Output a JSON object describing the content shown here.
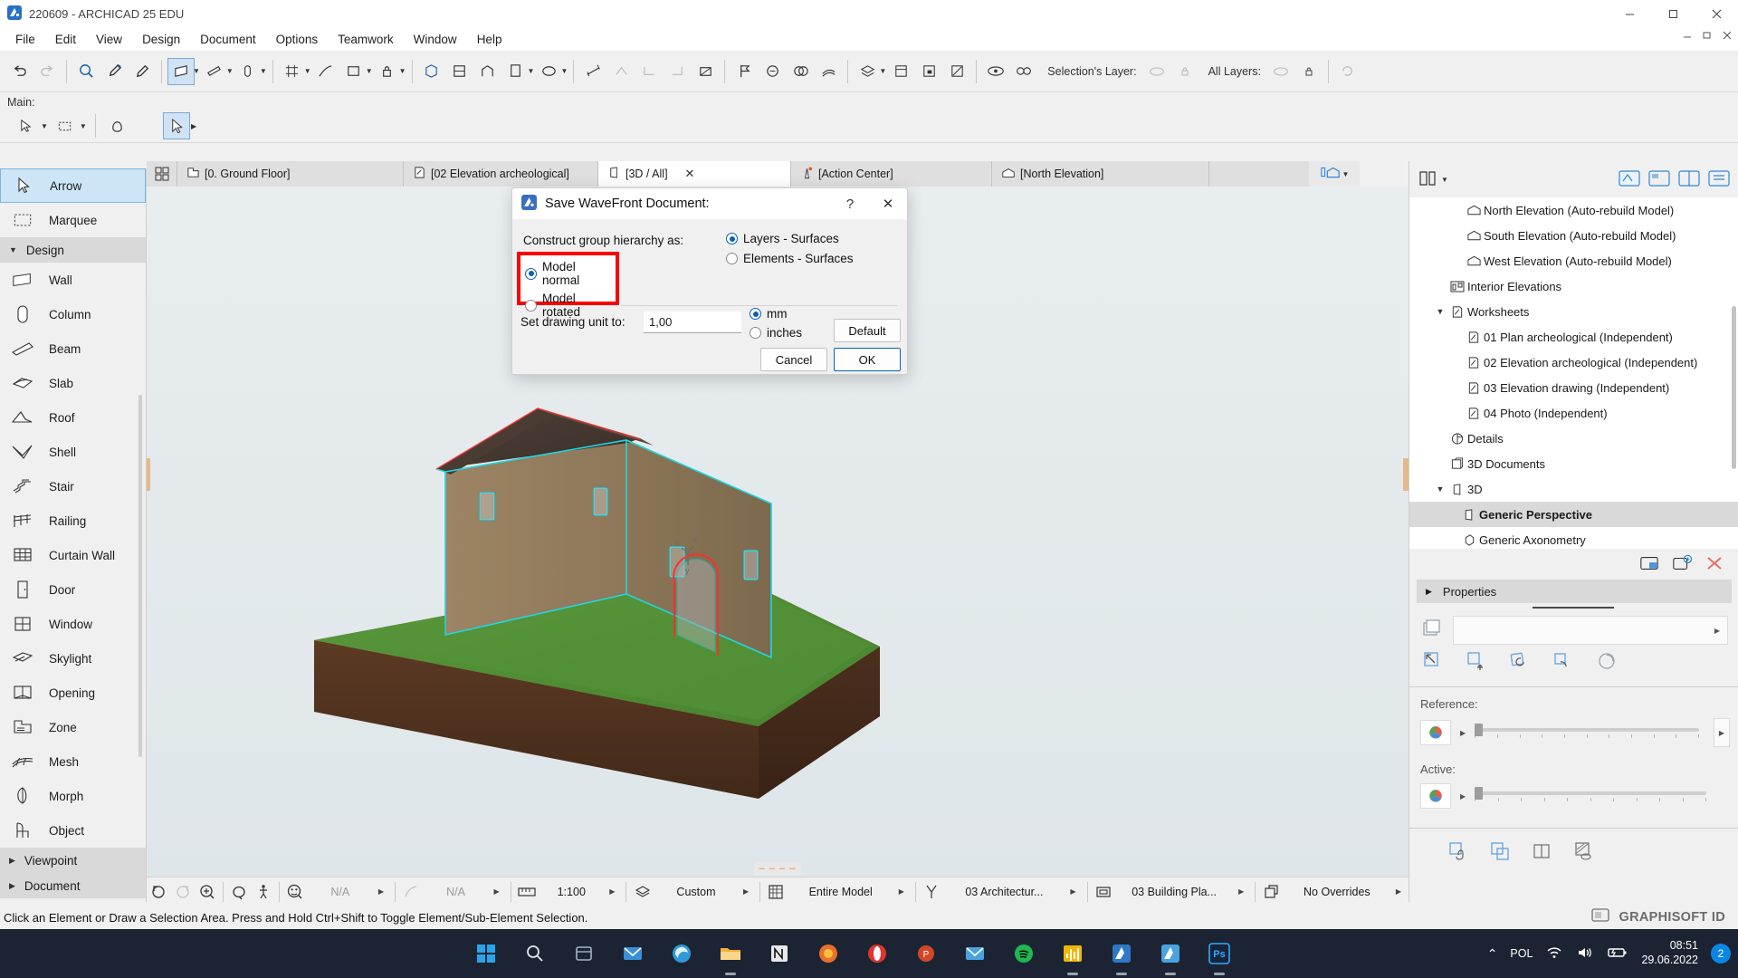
{
  "window": {
    "title": "220609 - ARCHICAD 25 EDU",
    "app_icon": "archicad-icon",
    "minimize": "–",
    "maximize": "▢",
    "close": "✕"
  },
  "menubar": {
    "items": [
      "File",
      "Edit",
      "View",
      "Design",
      "Document",
      "Options",
      "Teamwork",
      "Window",
      "Help"
    ]
  },
  "toolbar": {
    "selections_layer_label": "Selection's Layer:",
    "all_layers_label": "All Layers:"
  },
  "mainbar": {
    "label": "Main:"
  },
  "toolbox": {
    "items": [
      {
        "label": "Arrow",
        "icon": "arrow-cursor-icon",
        "active": true
      },
      {
        "label": "Marquee",
        "icon": "marquee-icon",
        "active": false
      },
      {
        "label": "Design",
        "icon": "group-collapse-icon",
        "group": true,
        "expanded": true
      },
      {
        "label": "Wall",
        "icon": "wall-icon",
        "active": false
      },
      {
        "label": "Column",
        "icon": "column-icon",
        "active": false
      },
      {
        "label": "Beam",
        "icon": "beam-icon",
        "active": false
      },
      {
        "label": "Slab",
        "icon": "slab-icon",
        "active": false
      },
      {
        "label": "Roof",
        "icon": "roof-icon",
        "active": false
      },
      {
        "label": "Shell",
        "icon": "shell-icon",
        "active": false
      },
      {
        "label": "Stair",
        "icon": "stair-icon",
        "active": false
      },
      {
        "label": "Railing",
        "icon": "railing-icon",
        "active": false
      },
      {
        "label": "Curtain Wall",
        "icon": "curtain-wall-icon",
        "active": false
      },
      {
        "label": "Door",
        "icon": "door-icon",
        "active": false
      },
      {
        "label": "Window",
        "icon": "window-icon",
        "active": false
      },
      {
        "label": "Skylight",
        "icon": "skylight-icon",
        "active": false
      },
      {
        "label": "Opening",
        "icon": "opening-icon",
        "active": false
      },
      {
        "label": "Zone",
        "icon": "zone-icon",
        "active": false
      },
      {
        "label": "Mesh",
        "icon": "mesh-icon",
        "active": false
      },
      {
        "label": "Morph",
        "icon": "morph-icon",
        "active": false
      },
      {
        "label": "Object",
        "icon": "object-icon",
        "active": false
      },
      {
        "label": "Viewpoint",
        "icon": "group-expand-icon",
        "group": true,
        "expanded": false
      },
      {
        "label": "Document",
        "icon": "group-expand-icon",
        "group": true,
        "expanded": false
      }
    ]
  },
  "tabs": [
    {
      "label": "[0. Ground Floor]",
      "icon": "floor-plan-icon",
      "active": false,
      "closable": false
    },
    {
      "label": "[02 Elevation archeological]",
      "icon": "worksheet-icon",
      "active": false,
      "closable": false
    },
    {
      "label": "[3D / All]",
      "icon": "3d-view-icon",
      "active": true,
      "closable": true
    },
    {
      "label": "[Action Center]",
      "icon": "action-center-icon",
      "active": false,
      "closable": false
    },
    {
      "label": "[North Elevation]",
      "icon": "elevation-icon",
      "active": false,
      "closable": false
    }
  ],
  "canvas": {
    "top_handle": "– – – –",
    "bottom_handle": "– – – –"
  },
  "navigator": {
    "tree": [
      {
        "label": "North Elevation (Auto-rebuild Model)",
        "icon": "elevation-icon",
        "indent": 2,
        "caret": "",
        "selected": false
      },
      {
        "label": "South Elevation (Auto-rebuild Model)",
        "icon": "elevation-icon",
        "indent": 2,
        "caret": "",
        "selected": false
      },
      {
        "label": "West Elevation (Auto-rebuild Model)",
        "icon": "elevation-icon",
        "indent": 2,
        "caret": "",
        "selected": false
      },
      {
        "label": "Interior Elevations",
        "icon": "interior-elevation-icon",
        "indent": 1,
        "caret": "",
        "selected": false
      },
      {
        "label": "Worksheets",
        "icon": "worksheet-icon",
        "indent": 1,
        "caret": "▼",
        "selected": false
      },
      {
        "label": "01 Plan archeological (Independent)",
        "icon": "worksheet-icon",
        "indent": 2,
        "caret": "",
        "selected": false
      },
      {
        "label": "02 Elevation archeological (Independent)",
        "icon": "worksheet-icon",
        "indent": 2,
        "caret": "",
        "selected": false
      },
      {
        "label": "03 Elevation drawing  (Independent)",
        "icon": "worksheet-icon",
        "indent": 2,
        "caret": "",
        "selected": false
      },
      {
        "label": "04 Photo  (Independent)",
        "icon": "worksheet-icon",
        "indent": 2,
        "caret": "",
        "selected": false
      },
      {
        "label": "Details",
        "icon": "details-icon",
        "indent": 1,
        "caret": "",
        "selected": false
      },
      {
        "label": "3D Documents",
        "icon": "3d-document-icon",
        "indent": 1,
        "caret": "",
        "selected": false
      },
      {
        "label": "3D",
        "icon": "3d-view-icon",
        "indent": 1,
        "caret": "▼",
        "selected": false
      },
      {
        "label": "Generic Perspective",
        "icon": "3d-view-icon",
        "indent": 2,
        "caret": "",
        "selected": true
      },
      {
        "label": "Generic Axonometry",
        "icon": "axonometry-icon",
        "indent": 2,
        "caret": "",
        "selected": false
      }
    ],
    "properties_label": "Properties",
    "reference_label": "Reference:",
    "active_label": "Active:"
  },
  "statusbar": {
    "value_na_1": "N/A",
    "value_na_2": "N/A",
    "scale": "1:100",
    "pen_set": "Custom",
    "model_view": "Entire Model",
    "renovation": "03 Architectur...",
    "layer_combo": "03 Building Pla...",
    "overrides": "No Overrides",
    "message": "Click an Element or Draw a Selection Area. Press and Hold Ctrl+Shift to Toggle Element/Sub-Element Selection.",
    "graphisoft_id": "GRAPHISOFT ID"
  },
  "dialog": {
    "title": "Save WaveFront Document:",
    "help_btn": "?",
    "close_btn": "✕",
    "construct_label": "Construct group hierarchy as:",
    "hierarchy_options": [
      {
        "label": "Layers - Surfaces",
        "selected": true
      },
      {
        "label": "Elements - Surfaces",
        "selected": false
      }
    ],
    "model_options": [
      {
        "label": "Model normal",
        "selected": true
      },
      {
        "label": "Model rotated",
        "selected": false
      }
    ],
    "unit_label": "Set drawing unit to:",
    "unit_value": "1,00",
    "unit_options": [
      {
        "label": "mm",
        "selected": true
      },
      {
        "label": "inches",
        "selected": false
      }
    ],
    "default_btn": "Default",
    "cancel_btn": "Cancel",
    "ok_btn": "OK",
    "highlight_color": "#f70404"
  },
  "taskbar": {
    "apps": [
      {
        "name": "start-windows-icon",
        "glyph": "▦",
        "color": "#2aa4e8",
        "running": false
      },
      {
        "name": "search-icon",
        "glyph": "◯",
        "color": "#dfe6ee",
        "running": false
      },
      {
        "name": "store-icon",
        "glyph": "▤",
        "color": "#9fb6cc",
        "running": false
      },
      {
        "name": "mail-icon",
        "glyph": "✉",
        "color": "#3a8fd8",
        "running": false
      },
      {
        "name": "edge-browser-icon",
        "glyph": "◉",
        "color": "#2f9ad6",
        "running": false
      },
      {
        "name": "file-explorer-icon",
        "glyph": "▭",
        "color": "#f0b33c",
        "running": true
      },
      {
        "name": "notion-icon",
        "glyph": "N",
        "color": "#e9e9e9",
        "running": false
      },
      {
        "name": "firefox-icon",
        "glyph": "◍",
        "color": "#e9702a",
        "running": false
      },
      {
        "name": "opera-icon",
        "glyph": "O",
        "color": "#e2342e",
        "running": false
      },
      {
        "name": "powerpoint-icon",
        "glyph": "P",
        "color": "#d24726",
        "running": false
      },
      {
        "name": "mail2-icon",
        "glyph": "✉",
        "color": "#4aa3df",
        "running": false
      },
      {
        "name": "spotify-icon",
        "glyph": "♫",
        "color": "#1db954",
        "running": false
      },
      {
        "name": "audacity-icon",
        "glyph": "▮",
        "color": "#f2b705",
        "running": true
      },
      {
        "name": "archicad-taskbar-icon",
        "glyph": "◣",
        "color": "#2f78c4",
        "running": true
      },
      {
        "name": "archicad-active-icon",
        "glyph": "◤",
        "color": "#4aa3df",
        "running": true
      },
      {
        "name": "photoshop-icon",
        "glyph": "Ps",
        "color": "#31a8ff",
        "running": true
      }
    ],
    "tray": {
      "chevron": "⌃",
      "language": "POL",
      "wifi": "wifi-icon",
      "volume": "volume-icon",
      "battery": "battery-charging-icon",
      "time": "08:51",
      "date": "29.06.2022",
      "notification_count": "2"
    }
  }
}
